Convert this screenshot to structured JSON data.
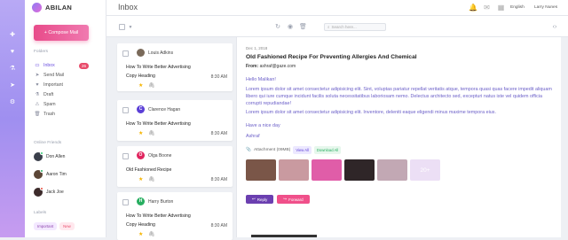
{
  "brand": {
    "name": "ABILAN"
  },
  "rail": {
    "icons": [
      "plus-icon",
      "heart-icon",
      "flask-icon",
      "send-icon",
      "gear-icon"
    ]
  },
  "compose": {
    "label": "+ Compose Mail"
  },
  "sidebar": {
    "folders_heading": "Folders",
    "folders": [
      {
        "label": "Inbox",
        "icon": "inbox-icon",
        "glyph": "▭",
        "badge": "26",
        "active": true
      },
      {
        "label": "Send Mail",
        "icon": "send-icon",
        "glyph": "➤"
      },
      {
        "label": "Important",
        "icon": "heart-icon",
        "glyph": "♥"
      },
      {
        "label": "Draft",
        "icon": "flask-icon",
        "glyph": "⚗"
      },
      {
        "label": "Spam",
        "icon": "warning-icon",
        "glyph": "⚠"
      },
      {
        "label": "Trash",
        "icon": "trash-icon",
        "glyph": "🗑"
      }
    ],
    "friends_heading": "Online Friends",
    "friends": [
      {
        "name": "Don Allen",
        "avatar_color": "#3a3f4b",
        "status_color": "#2ecc71"
      },
      {
        "name": "Aaron Tim",
        "avatar_color": "#5b4636",
        "status_color": "#27ae60"
      },
      {
        "name": "Jack Joe",
        "avatar_color": "#3d2b2b",
        "status_color": "#e74c3c"
      }
    ],
    "labels_heading": "Labels",
    "labels": [
      {
        "text": "Important",
        "bg": "#f3e8ff",
        "color": "#8e44ad"
      },
      {
        "text": "New",
        "bg": "#ffe8ee",
        "color": "#e84b6a"
      }
    ]
  },
  "topbar": {
    "title": "Inbox",
    "language": "English",
    "user": "Larry Nunes"
  },
  "toolbar": {
    "search_placeholder": "Search here..."
  },
  "emails": [
    {
      "sender": "Louis Adkins",
      "avatar_letter": "",
      "avatar_color": "#7a6a5a",
      "subject_lines": [
        "How To Write Better Advertising",
        "Copy Heading"
      ],
      "time": "8:30 AM"
    },
    {
      "sender": "Clarence Hagan",
      "avatar_letter": "C",
      "avatar_color": "#5b3fd6",
      "subject_lines": [
        "How To Write Better Advertising"
      ],
      "time": "8:30 AM"
    },
    {
      "sender": "Olga Boone",
      "avatar_letter": "O",
      "avatar_color": "#e0245e",
      "subject_lines": [
        "Old Fashioned Recipe"
      ],
      "time": "8:30 AM"
    },
    {
      "sender": "Harry Burton",
      "avatar_letter": "H",
      "avatar_color": "#27ae60",
      "subject_lines": [
        "How To Write Better Advertising",
        "Copy Heading"
      ],
      "time": "8:30 AM"
    }
  ],
  "message": {
    "date": "Dec 1, 2018",
    "subject": "Old Fashioned Recipe For Preventing Allergies And Chemical",
    "from_label": "From: ",
    "from_address": "ashraf@gaze.com",
    "greeting": "Hello Malikan!",
    "paragraph1": "Lorem ipsum dolor sit amet consectetur adipisicing elit. Sint, voluptas pariatur repellat veritatis atque, tempora quasi quas facere impedit aliquam libero qui iure cumque incidunt facilis soluta necessitatibus laboriosam nemo. Delectus architecto sed, excepturi natus iste vel quidem officia corrupti repudiandae!",
    "paragraph2": "Lorem ipsum dolor sit amet consectetur adipisicing elit. Inventore, deleniti eaque eligendi minus maxime tempora eius.",
    "closing": "Have a nice day",
    "signature": "Ashraf",
    "attachment_label": "Attachment (09MB)",
    "view_all": "View All",
    "download_all": "Download All",
    "thumbnails": [
      {
        "name": "photo-1",
        "color": "#7a5648"
      },
      {
        "name": "photo-2",
        "color": "#c99aa0"
      },
      {
        "name": "photo-3",
        "color": "#e05da8"
      },
      {
        "name": "photo-4",
        "color": "#2f2628"
      },
      {
        "name": "photo-5",
        "color": "#c2a8b4"
      }
    ],
    "more_count": "20+",
    "reply_label": "Reply",
    "forward_label": "Forward"
  }
}
